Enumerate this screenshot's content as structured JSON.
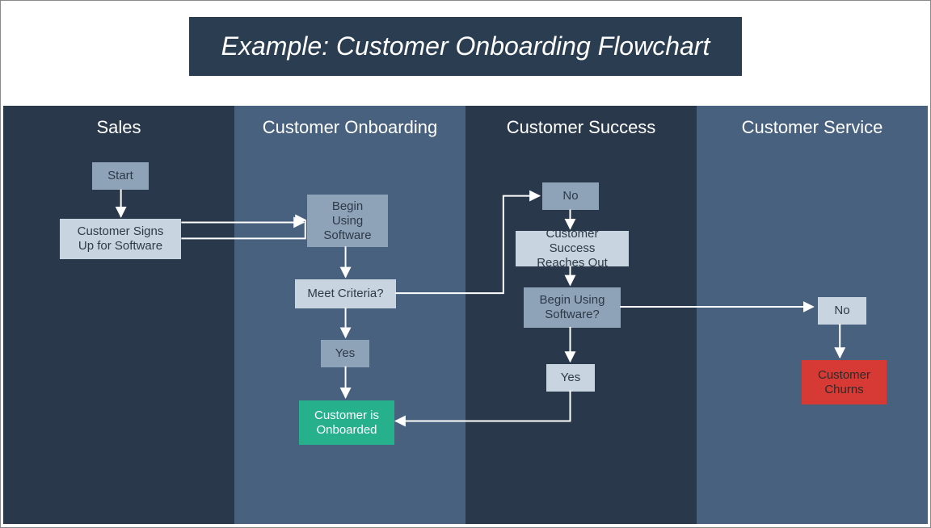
{
  "title": "Example: Customer Onboarding Flowchart",
  "lanes": {
    "l1": "Sales",
    "l2": "Customer Onboarding",
    "l3": "Customer Success",
    "l4": "Customer Service"
  },
  "nodes": {
    "start": "Start",
    "signup": "Customer Signs Up for Software",
    "begin": "Begin Using Software",
    "criteria": "Meet Criteria?",
    "yes1": "Yes",
    "onboarded": "Customer is Onboarded",
    "no1": "No",
    "reachout": "Customer Success Reaches Out",
    "begin2": "Begin Using Software?",
    "yes2": "Yes",
    "no2": "No",
    "churns": "Customer Churns"
  },
  "colors": {
    "lane_dark": "#29394b",
    "lane_mid": "#48617e",
    "node_light": "#c8d4e0",
    "node_steel": "#8ea2b8",
    "green": "#26b08c",
    "red": "#d73a34",
    "arrow": "#ffffff"
  }
}
